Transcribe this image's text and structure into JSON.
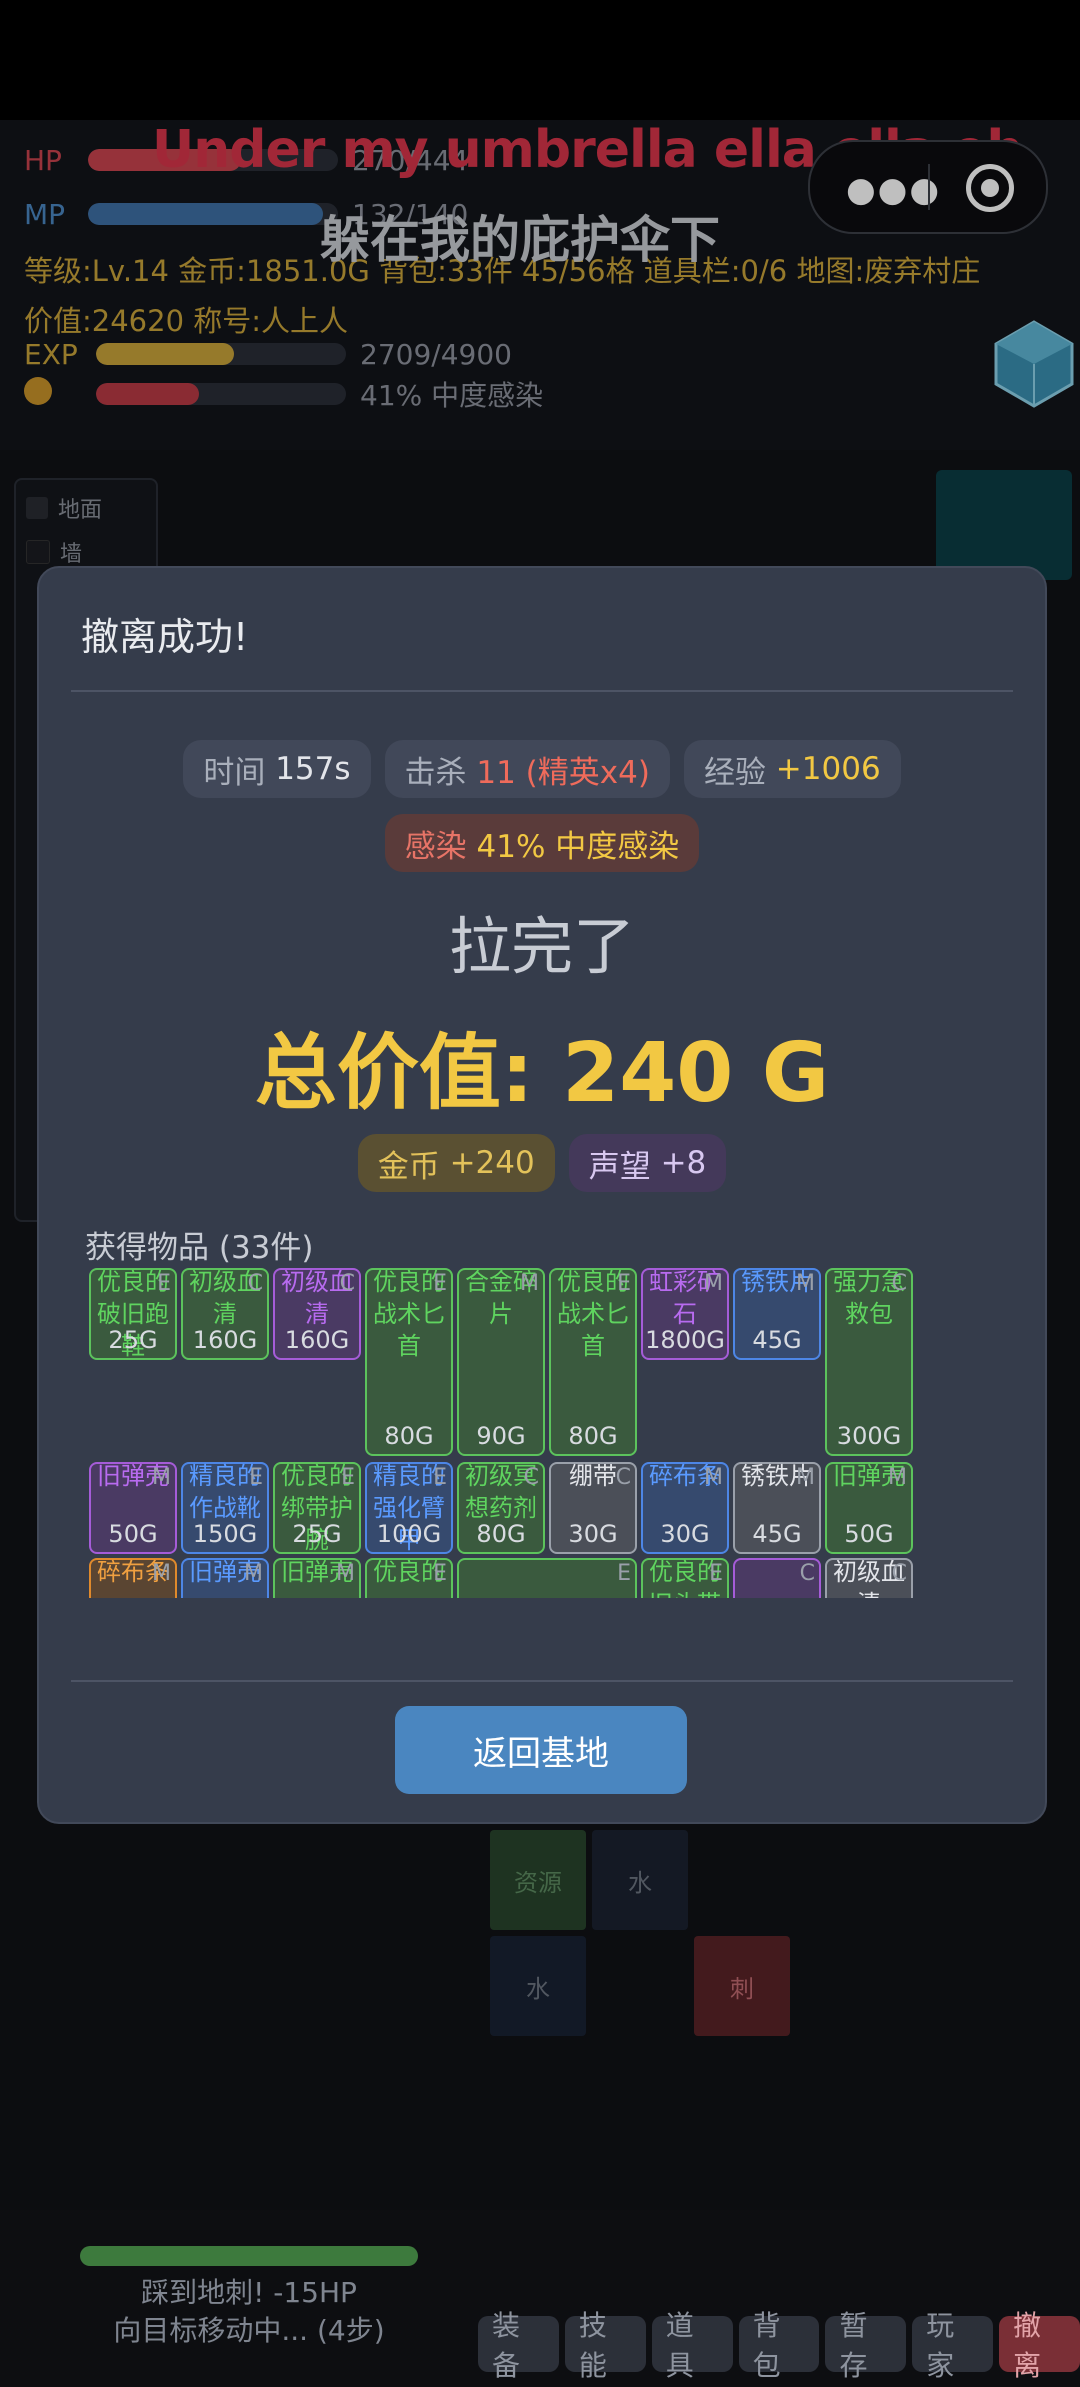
{
  "hud": {
    "hp_label": "HP",
    "hp_value": "270/444",
    "hp_fraction": 0.61,
    "mp_label": "MP",
    "mp_value": "132/140",
    "mp_fraction": 0.94,
    "stats_line1": "等级:Lv.14  金币:1851.0G  背包:33件 45/56格  道具栏:0/6  地图:废弃村庄",
    "stats_line2": "价值:24620  称号:人上人",
    "exp_label": "EXP",
    "exp_value": "2709/4900",
    "exp_fraction": 0.55,
    "infect_value": "41% 中度感染",
    "infect_fraction": 0.41
  },
  "lyrics": {
    "line1": "Under my umbrella ella ella eh",
    "line2": "躲在我的庇护伞下"
  },
  "capsule": {
    "more_icon": "more-dots-icon",
    "close_icon": "target-circle-icon"
  },
  "legend": {
    "items": [
      {
        "label": "地面",
        "color": "#2a2d33"
      },
      {
        "label": "墙",
        "color": "#1b1d22"
      }
    ]
  },
  "map_cells": [
    "资源",
    "水",
    "水",
    "刺"
  ],
  "bottom": {
    "log_line1": "踩到地刺! -15HP",
    "log_line2": "向目标移动中... (4步)",
    "menu": [
      "装备",
      "技能",
      "道具",
      "背包",
      "暂存",
      "玩家",
      "撤离"
    ]
  },
  "modal": {
    "title": "撤离成功!",
    "time_label": "时间",
    "time_value": "157s",
    "kill_label": "击杀",
    "kill_value": "11 (精英x4)",
    "exp_label": "经验",
    "exp_value": "+1006",
    "infect_label": "感染",
    "infect_value": "41% 中度感染",
    "headline": "拉完了",
    "total": "总价值: 240 G",
    "gold_label": "金币",
    "gold_value": "+240",
    "fame_label": "声望",
    "fame_value": "+8",
    "items_title": "获得物品 (33件)",
    "return_button": "返回基地"
  },
  "items": [
    {
      "name": "优良的破旧跑鞋",
      "price": "25G",
      "tag": "E",
      "rarity": "g"
    },
    {
      "name": "初级血清",
      "price": "160G",
      "tag": "C",
      "rarity": "g"
    },
    {
      "name": "初级血清",
      "price": "160G",
      "tag": "C",
      "rarity": "p"
    },
    {
      "name": "优良的战术匕首",
      "price": "80G",
      "tag": "E",
      "rarity": "g"
    },
    {
      "name": "合金碎片",
      "price": "90G",
      "tag": "M",
      "rarity": "g"
    },
    {
      "name": "优良的战术匕首",
      "price": "80G",
      "tag": "E",
      "rarity": "g"
    },
    {
      "name": "虹彩矿石",
      "price": "1800G",
      "tag": "M",
      "rarity": "p"
    },
    {
      "name": "锈铁片",
      "price": "45G",
      "tag": "M",
      "rarity": "b"
    },
    {
      "name": "强力急救包",
      "price": "300G",
      "tag": "C",
      "rarity": "g"
    },
    {
      "name": "旧弹壳",
      "price": "50G",
      "tag": "M",
      "rarity": "p"
    },
    {
      "name": "精良的作战靴",
      "price": "150G",
      "tag": "E",
      "rarity": "b"
    },
    {
      "name": "优良的绑带护腕",
      "price": "25G",
      "tag": "E",
      "rarity": "g"
    },
    {
      "name": "精良的强化臂甲",
      "price": "100G",
      "tag": "E",
      "rarity": "b"
    },
    {
      "name": "初级冥想药剂",
      "price": "80G",
      "tag": "C",
      "rarity": "g"
    },
    {
      "name": "绷带",
      "price": "30G",
      "tag": "C",
      "rarity": "w"
    },
    {
      "name": "碎布条",
      "price": "30G",
      "tag": "M",
      "rarity": "b"
    },
    {
      "name": "锈铁片",
      "price": "45G",
      "tag": "M",
      "rarity": "w"
    },
    {
      "name": "旧弹壳",
      "price": "50G",
      "tag": "M",
      "rarity": "g"
    },
    {
      "name": "碎布条",
      "price": "",
      "tag": "M",
      "rarity": "o"
    },
    {
      "name": "旧弹壳",
      "price": "",
      "tag": "M",
      "rarity": "b"
    },
    {
      "name": "旧弹壳",
      "price": "",
      "tag": "M",
      "rarity": "g"
    },
    {
      "name": "优良的",
      "price": "",
      "tag": "E",
      "rarity": "g"
    },
    {
      "name": "",
      "price": "",
      "tag": "E",
      "rarity": "g"
    },
    {
      "name": "优良的旧头带",
      "price": "",
      "tag": "E",
      "rarity": "g"
    },
    {
      "name": "",
      "price": "",
      "tag": "C",
      "rarity": "p"
    },
    {
      "name": "初级血清",
      "price": "",
      "tag": "C",
      "rarity": "w"
    }
  ]
}
